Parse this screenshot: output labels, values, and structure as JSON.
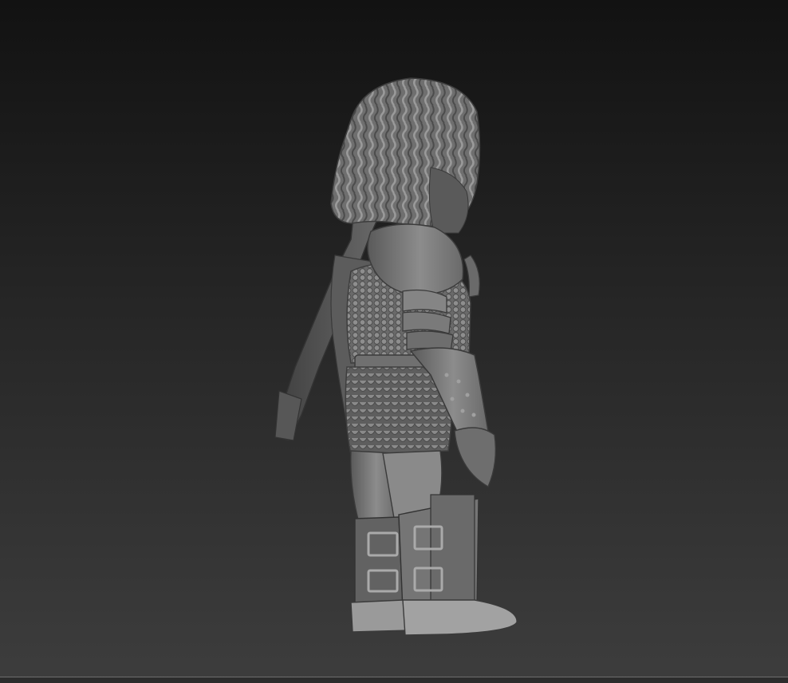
{
  "viewport": {
    "background_top": "#121212",
    "background_bottom": "#3d3d3d",
    "model_color": "#8a8a8a"
  },
  "model": {
    "subject": "armored-warrior-sculpt"
  }
}
